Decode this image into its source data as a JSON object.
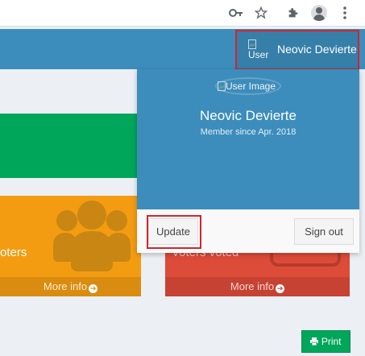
{
  "browser": {
    "icons": [
      "key-icon",
      "star-icon",
      "puzzle-icon",
      "account-icon",
      "kebab-menu-icon"
    ]
  },
  "header": {
    "user_image_alt": "User",
    "user_name": "Neovic Devierte"
  },
  "dropdown": {
    "user_image_alt": "User Image",
    "name": "Neovic Devierte",
    "member_since": "Member since Apr. 2018",
    "update_label": "Update",
    "signout_label": "Sign out"
  },
  "boxes": [
    {
      "label": "oters",
      "more_info": "More info",
      "color": "#f39c12"
    },
    {
      "label": "Voters voted",
      "more_info": "More info",
      "color": "#dd4b39"
    }
  ],
  "green_box_color": "#00a65a",
  "print_label": "Print",
  "colors": {
    "navbar": "#3c8dbc",
    "highlight": "#d0262e"
  }
}
